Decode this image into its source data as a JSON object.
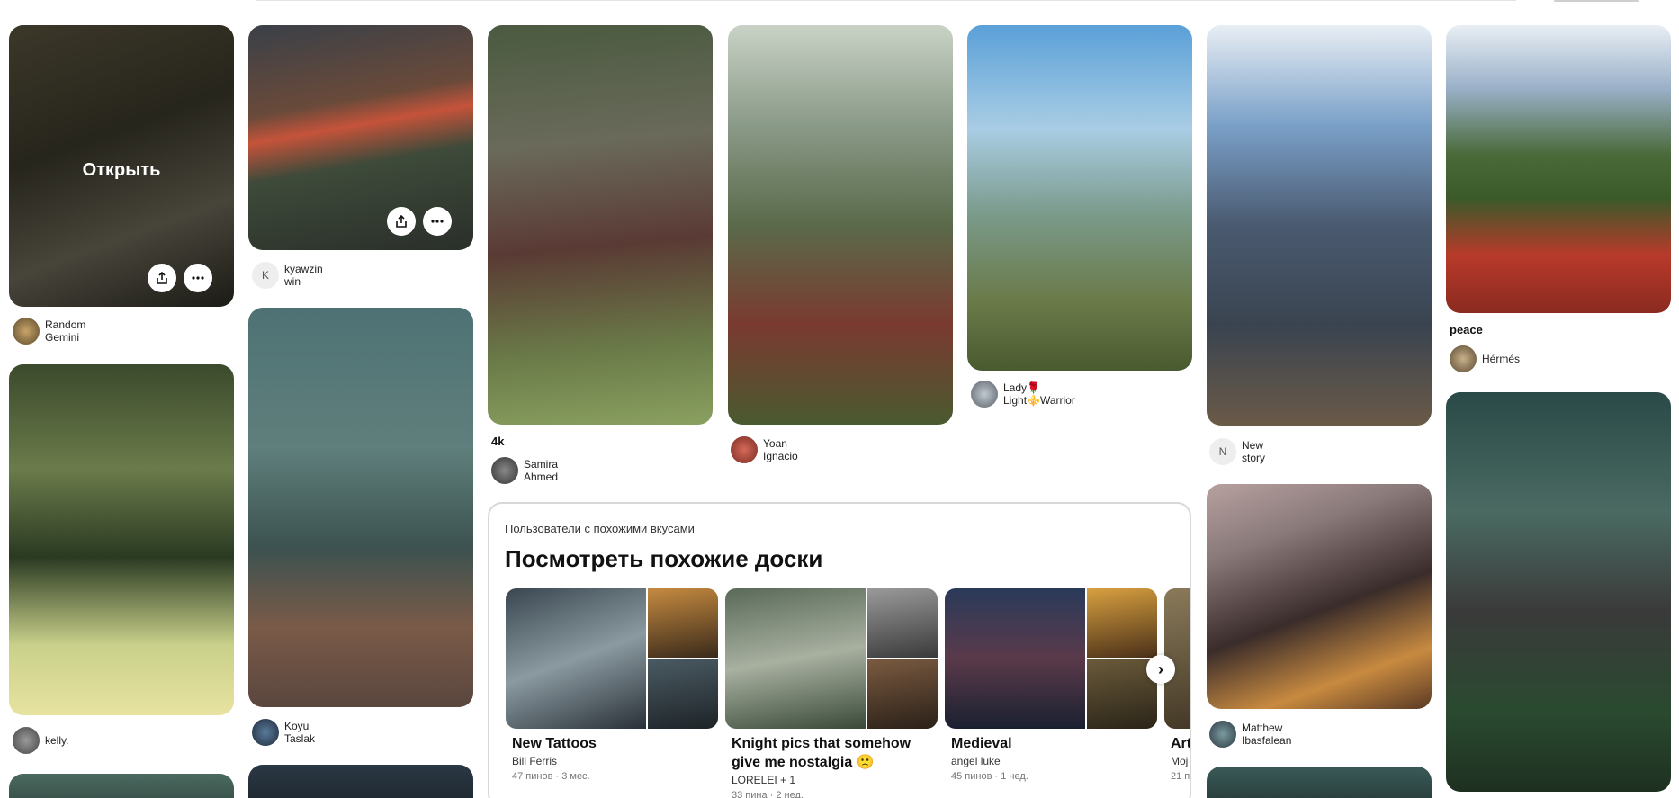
{
  "overlay": {
    "open_label": "Открыть",
    "share_icon": "share-icon",
    "more_icon": "more-icon"
  },
  "pins": [
    {
      "author": "Random Gemini",
      "title": ""
    },
    {
      "author": "kyawzin win",
      "avatar_letter": "K"
    },
    {
      "author": "kelly."
    },
    {
      "author": "Koyu Taslak"
    },
    {
      "author": "Samira Ahmed",
      "title": "4k"
    },
    {
      "author": "Yoan Ignacio"
    },
    {
      "author": "Lady🌹 Light⚜️Warrior"
    },
    {
      "author": "New story",
      "avatar_letter": "N"
    },
    {
      "author": "Matthew Ibasfalean"
    },
    {
      "author": "Hérmés",
      "title": "peace"
    }
  ],
  "boards_section": {
    "subtitle": "Пользователи с похожими вкусами",
    "title": "Посмотреть похожие доски",
    "next_icon": "chevron-right-icon",
    "boards": [
      {
        "name": "New Tattoos",
        "owner": "Bill Ferris",
        "meta": "47 пинов · 3 мес."
      },
      {
        "name": "Knight pics that somehow give me nostalgia 🙁",
        "owner": "LORELEI + 1",
        "meta": "33 пина · 2 нед."
      },
      {
        "name": "Medieval",
        "owner": "angel luke",
        "meta": "45 пинов · 1 нед."
      },
      {
        "name": "Art",
        "owner": "Moj",
        "meta": "21 п"
      }
    ]
  },
  "colors": {
    "overlay_dim": "#000000",
    "board_border": "#d8d8d8",
    "meta_gray": "#767676"
  }
}
